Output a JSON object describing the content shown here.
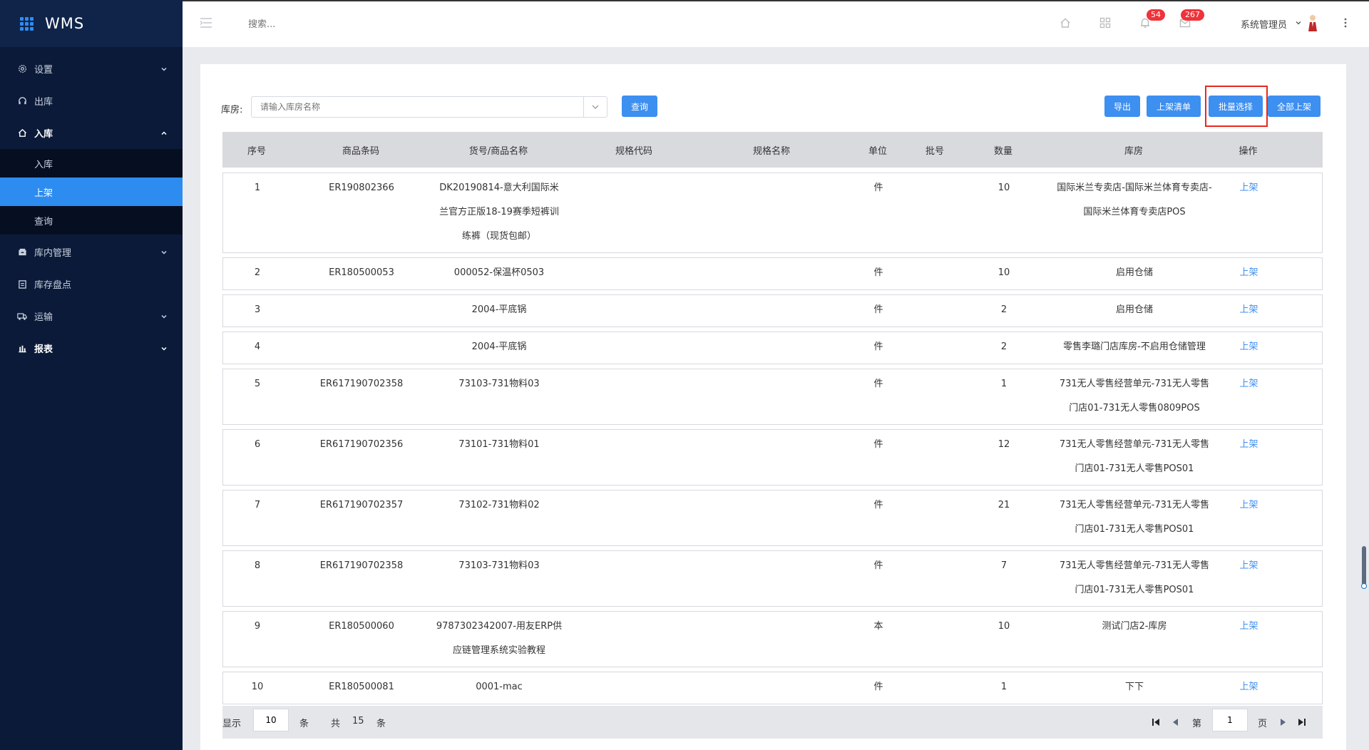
{
  "app": {
    "title": "WMS"
  },
  "colors": {
    "sidebar": "#0b1a38",
    "accent": "#3d8ff0",
    "badge": "#f0333a",
    "highlight": "#e8271e"
  },
  "sidebar": {
    "items": [
      {
        "label": "设置",
        "icon": "gear-icon"
      },
      {
        "label": "出库",
        "icon": "headset-icon"
      },
      {
        "label": "入库",
        "icon": "home-icon"
      },
      {
        "label": "库内管理",
        "icon": "box-icon"
      },
      {
        "label": "库存盘点",
        "icon": "clipboard-icon"
      },
      {
        "label": "运输",
        "icon": "truck-icon"
      },
      {
        "label": "报表",
        "icon": "bar-chart-icon"
      }
    ],
    "submenu": [
      {
        "label": "入库"
      },
      {
        "label": "上架"
      },
      {
        "label": "查询"
      }
    ]
  },
  "header": {
    "search_placeholder": "搜索...",
    "notification_count": "54",
    "message_count": "267",
    "user_name": "系统管理员"
  },
  "filter": {
    "store_label": "库房:",
    "store_placeholder": "请输入库房名称",
    "query_button": "查询"
  },
  "actions": {
    "export": "导出",
    "shelf_list": "上架清单",
    "batch_select": "批量选择",
    "shelve_all": "全部上架"
  },
  "table": {
    "columns": [
      "序号",
      "商品条码",
      "货号/商品名称",
      "规格代码",
      "规格名称",
      "单位",
      "批号",
      "数量",
      "库房",
      "操作"
    ],
    "rows": [
      {
        "no": "1",
        "barcode": "ER190802366",
        "name": "DK20190814-意大利国际米兰官方正版18-19赛季短裤训练裤（现货包邮）",
        "spec_code": "",
        "spec_name": "",
        "unit": "件",
        "batch": "",
        "qty": "10",
        "store": "国际米兰专卖店-国际米兰体育专卖店-国际米兰体育专卖店POS",
        "op": "上架"
      },
      {
        "no": "2",
        "barcode": "ER180500053",
        "name": "000052-保温杯0503",
        "spec_code": "",
        "spec_name": "",
        "unit": "件",
        "batch": "",
        "qty": "10",
        "store": "启用仓储",
        "op": "上架"
      },
      {
        "no": "3",
        "barcode": "",
        "name": "2004-平底锅",
        "spec_code": "",
        "spec_name": "",
        "unit": "件",
        "batch": "",
        "qty": "2",
        "store": "启用仓储",
        "op": "上架"
      },
      {
        "no": "4",
        "barcode": "",
        "name": "2004-平底锅",
        "spec_code": "",
        "spec_name": "",
        "unit": "件",
        "batch": "",
        "qty": "2",
        "store": "零售李璐门店库房-不启用仓储管理",
        "op": "上架"
      },
      {
        "no": "5",
        "barcode": "ER617190702358",
        "name": "73103-731物料03",
        "spec_code": "",
        "spec_name": "",
        "unit": "件",
        "batch": "",
        "qty": "1",
        "store": "731无人零售经营单元-731无人零售门店01-731无人零售0809POS",
        "op": "上架"
      },
      {
        "no": "6",
        "barcode": "ER617190702356",
        "name": "73101-731物料01",
        "spec_code": "",
        "spec_name": "",
        "unit": "件",
        "batch": "",
        "qty": "12",
        "store": "731无人零售经营单元-731无人零售门店01-731无人零售POS01",
        "op": "上架"
      },
      {
        "no": "7",
        "barcode": "ER617190702357",
        "name": "73102-731物料02",
        "spec_code": "",
        "spec_name": "",
        "unit": "件",
        "batch": "",
        "qty": "21",
        "store": "731无人零售经营单元-731无人零售门店01-731无人零售POS01",
        "op": "上架"
      },
      {
        "no": "8",
        "barcode": "ER617190702358",
        "name": "73103-731物料03",
        "spec_code": "",
        "spec_name": "",
        "unit": "件",
        "batch": "",
        "qty": "7",
        "store": "731无人零售经营单元-731无人零售门店01-731无人零售POS01",
        "op": "上架"
      },
      {
        "no": "9",
        "barcode": "ER180500060",
        "name": "9787302342007-用友ERP供应链管理系统实验教程",
        "spec_code": "",
        "spec_name": "",
        "unit": "本",
        "batch": "",
        "qty": "10",
        "store": "测试门店2-库房",
        "op": "上架"
      },
      {
        "no": "10",
        "barcode": "ER180500081",
        "name": "0001-mac",
        "spec_code": "",
        "spec_name": "",
        "unit": "件",
        "batch": "",
        "qty": "1",
        "store": "下下",
        "op": "上架"
      }
    ]
  },
  "pager": {
    "show_label": "显示",
    "page_size": "10",
    "unit_label": "条",
    "total_prefix": "共",
    "total": "15",
    "total_suffix": "条",
    "page_prefix": "第",
    "current_page": "1",
    "page_suffix": "页"
  }
}
